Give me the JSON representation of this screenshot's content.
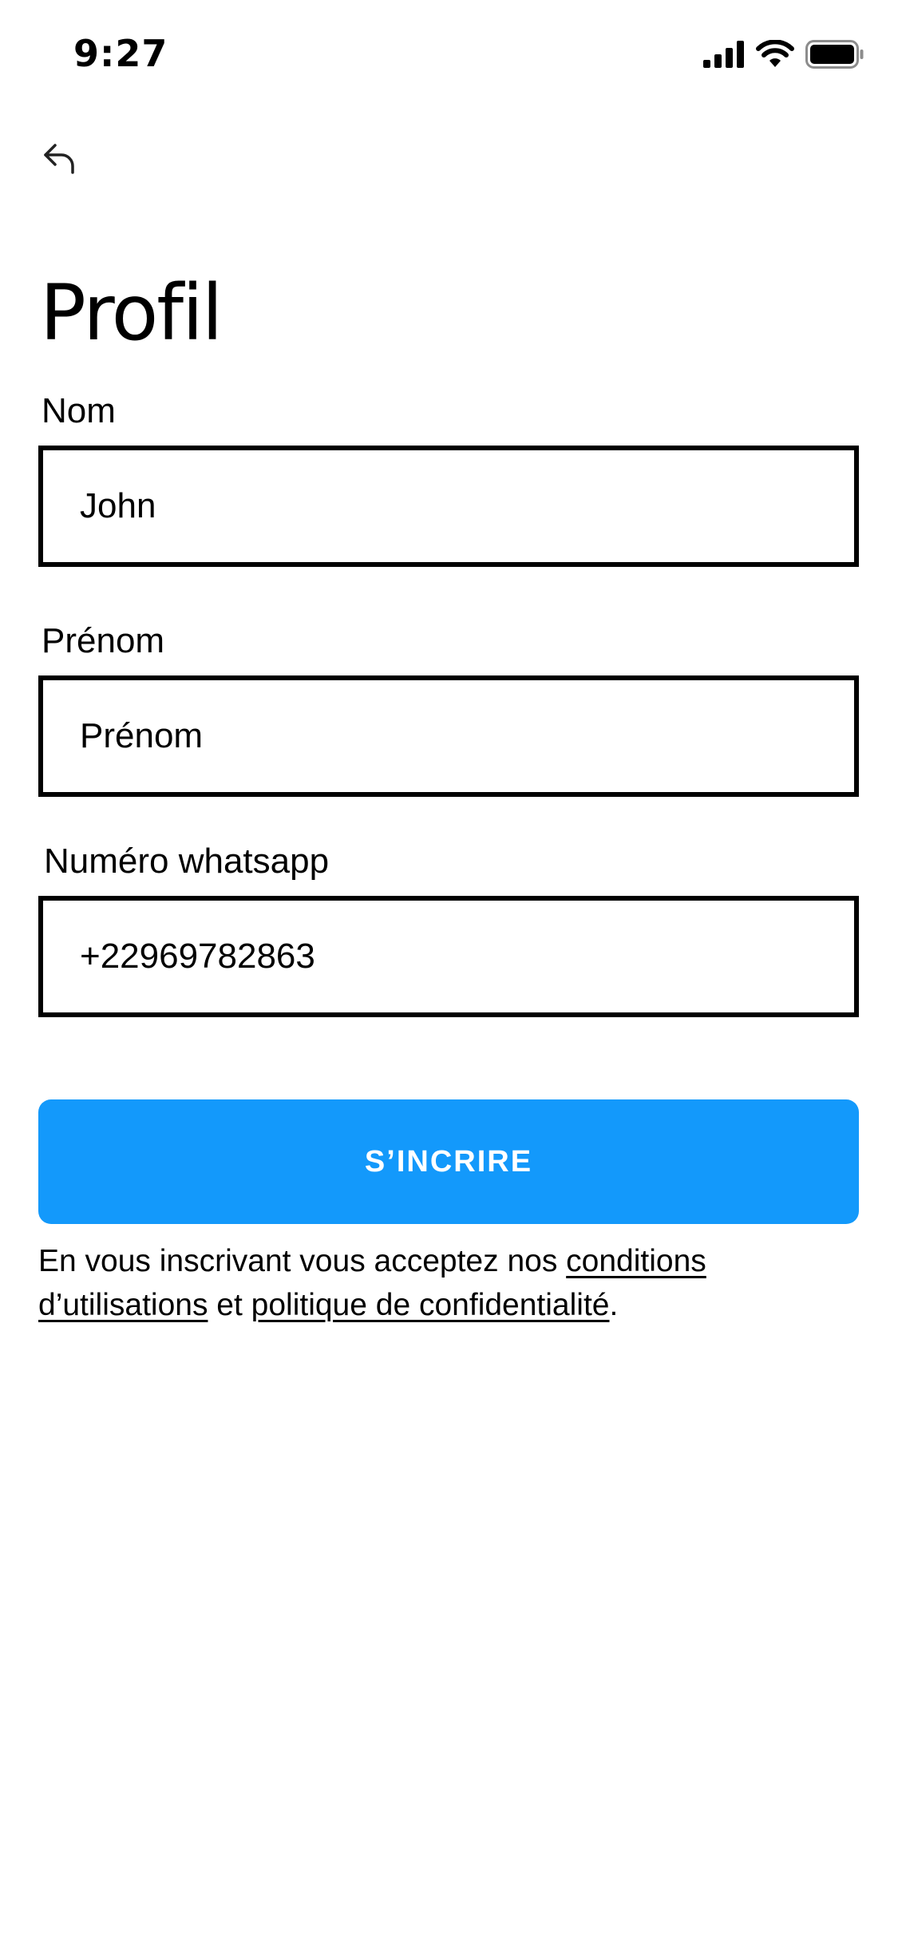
{
  "status_bar": {
    "time": "9:27",
    "icons": [
      "cellular-signal-icon",
      "wifi-icon",
      "battery-icon"
    ]
  },
  "nav": {
    "back_icon": "back-arrow-icon"
  },
  "page": {
    "title": "Profil"
  },
  "form": {
    "nom": {
      "label": "Nom",
      "value": "John",
      "placeholder": ""
    },
    "prenom": {
      "label": "Prénom",
      "value": "",
      "placeholder": "Prénom"
    },
    "whatsapp": {
      "label": "Numéro whatsapp",
      "value": "+22969782863",
      "placeholder": ""
    },
    "submit_label": "S’INCRIRE"
  },
  "terms": {
    "prefix": "En vous inscrivant vous acceptez nos ",
    "conditions_link": "conditions d’utilisations",
    "middle": " et ",
    "privacy_link": "politique de confidentialité",
    "suffix": "."
  },
  "colors": {
    "accent": "#1399fb",
    "text": "#000000",
    "background": "#ffffff"
  }
}
